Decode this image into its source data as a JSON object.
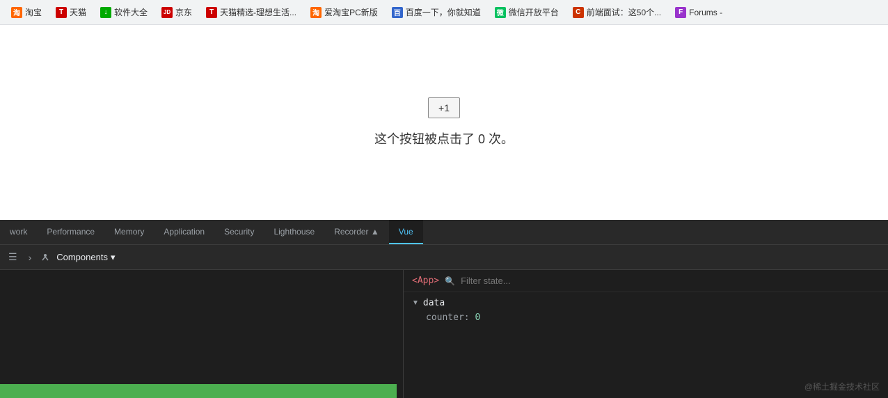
{
  "bookmarks": {
    "items": [
      {
        "label": "淘宝",
        "color": "#ff6600",
        "icon": "T",
        "icon_text": "淘"
      },
      {
        "label": "天猫",
        "color": "#cc0000",
        "icon": "T"
      },
      {
        "label": "软件大全",
        "color": "#00aa00",
        "icon": "↓"
      },
      {
        "label": "京东",
        "color": "#cc0000",
        "icon": "JD"
      },
      {
        "label": "天猫精选-理想生活...",
        "color": "#cc0000",
        "icon": "T"
      },
      {
        "label": "爱淘宝PC新版",
        "color": "#ff6600",
        "icon": "淘"
      },
      {
        "label": "百度一下，你就知道",
        "color": "#3366cc",
        "icon": "百"
      },
      {
        "label": "微信开放平台",
        "color": "#07c160",
        "icon": "微"
      },
      {
        "label": "前端面试：这50个...",
        "color": "#cc3300",
        "icon": "C"
      },
      {
        "label": "Forums -",
        "color": "#9933cc",
        "icon": "F"
      }
    ]
  },
  "main": {
    "counter_button_label": "+1",
    "counter_text": "这个按钮被点击了 0 次。"
  },
  "devtools": {
    "tabs": [
      {
        "label": "work",
        "active": false
      },
      {
        "label": "Performance",
        "active": false
      },
      {
        "label": "Memory",
        "active": false
      },
      {
        "label": "Application",
        "active": false
      },
      {
        "label": "Security",
        "active": false
      },
      {
        "label": "Lighthouse",
        "active": false
      },
      {
        "label": "Recorder ▲",
        "active": false
      },
      {
        "label": "Vue",
        "active": true
      }
    ],
    "toolbar": {
      "components_label": "Components",
      "dropdown_icon": "▾"
    },
    "right_panel": {
      "app_tag": "<App>",
      "filter_placeholder": "Filter state...",
      "data_label": "data",
      "counter_property": "counter: 0"
    },
    "watermark": "@稀土掘金技术社区"
  }
}
